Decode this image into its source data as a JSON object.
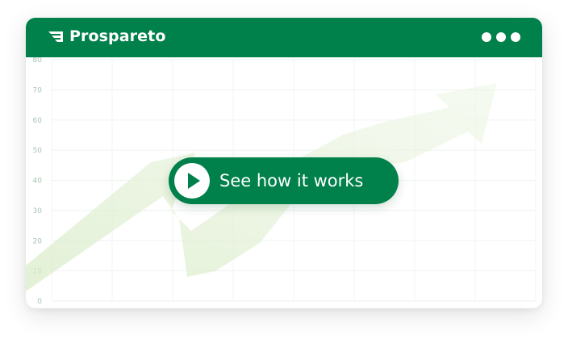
{
  "app": {
    "brand_name": "Prospareto"
  },
  "header": {
    "menu_icon": "more-dots-icon"
  },
  "chart": {
    "y_ticks": [
      "0",
      "10",
      "20",
      "30",
      "40",
      "50",
      "60",
      "70",
      "80"
    ],
    "trend_icon": "up-arrow-trend"
  },
  "cta": {
    "label": "See how it works",
    "icon": "play-icon"
  },
  "colors": {
    "brand_green": "#00804a",
    "header_text": "#ffffff",
    "chart_tint": "#e6f3dc"
  }
}
